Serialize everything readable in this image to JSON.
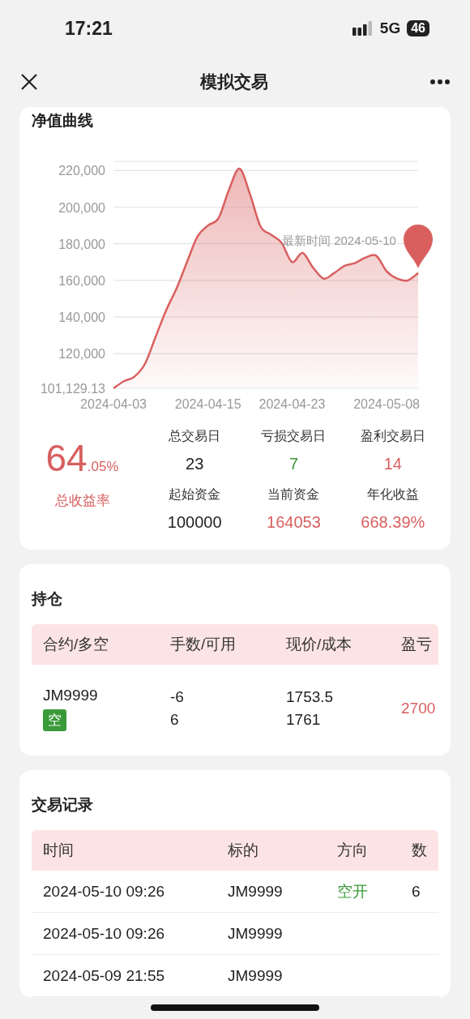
{
  "status_bar": {
    "time": "17:21",
    "network": "5G",
    "battery": "46"
  },
  "nav": {
    "title": "模拟交易"
  },
  "equity_card": {
    "title": "净值曲线",
    "chart_data": {
      "type": "area",
      "categories": [
        "2024-04-03",
        null,
        null,
        null,
        null,
        null,
        null,
        null,
        null,
        "2024-04-15",
        null,
        null,
        null,
        null,
        null,
        null,
        null,
        "2024-04-23",
        null,
        null,
        null,
        null,
        null,
        null,
        null,
        null,
        "2024-05-08",
        null,
        null,
        null
      ],
      "series": [
        {
          "color": "#d95f5f",
          "values": [
            101129.13,
            105000,
            107500,
            114500,
            129000,
            143500,
            155500,
            170000,
            184000,
            190000,
            194000,
            209500,
            221000,
            207000,
            189500,
            185000,
            180500,
            170000,
            175000,
            167000,
            161000,
            164000,
            168000,
            169500,
            172500,
            173500,
            165000,
            161000,
            160000,
            164000
          ]
        }
      ],
      "ylim": [
        101129.13,
        225000
      ],
      "grid": true,
      "yticks": [
        {
          "value": 101129.13,
          "label": "101,129.13"
        },
        {
          "value": 120000,
          "label": "120,000"
        },
        {
          "value": 140000,
          "label": "140,000"
        },
        {
          "value": 160000,
          "label": "160,000"
        },
        {
          "value": 180000,
          "label": "180,000"
        },
        {
          "value": 200000,
          "label": "200,000"
        },
        {
          "value": 220000,
          "label": "220,000"
        }
      ],
      "annotations": [
        "最新时间 2024-05-10"
      ]
    },
    "total_return": {
      "integer": "64",
      "fraction": ".05%",
      "label": "总收益率"
    },
    "stats": [
      {
        "label": "总交易日",
        "value": "23",
        "color": "#222222"
      },
      {
        "label": "亏损交易日",
        "value": "7",
        "color": "#3a9a3a"
      },
      {
        "label": "盈利交易日",
        "value": "14",
        "color": "#d95f5f"
      },
      {
        "label": "起始资金",
        "value": "100000",
        "color": "#222222"
      },
      {
        "label": "当前资金",
        "value": "164053",
        "color": "#d95f5f"
      },
      {
        "label": "年化收益",
        "value": "668.39%",
        "color": "#d95f5f"
      }
    ]
  },
  "positions": {
    "title": "持仓",
    "columns": [
      "合约/多空",
      "手数/可用",
      "现价/成本",
      "盈亏"
    ],
    "rows": [
      {
        "contract": "JM9999",
        "side": "空",
        "lots": "-6",
        "available": "6",
        "price": "1753.5",
        "cost": "1761",
        "pnl": "2700"
      }
    ]
  },
  "trades": {
    "title": "交易记录",
    "columns": [
      "时间",
      "标的",
      "方向",
      "数"
    ],
    "rows": [
      {
        "time": "2024-05-10 09:26",
        "symbol": "JM9999",
        "direction": "空开",
        "qty": "6"
      },
      {
        "time": "2024-05-10 09:26",
        "symbol": "JM9999"
      },
      {
        "time": "2024-05-09 21:55",
        "symbol": "JM9999"
      }
    ]
  }
}
